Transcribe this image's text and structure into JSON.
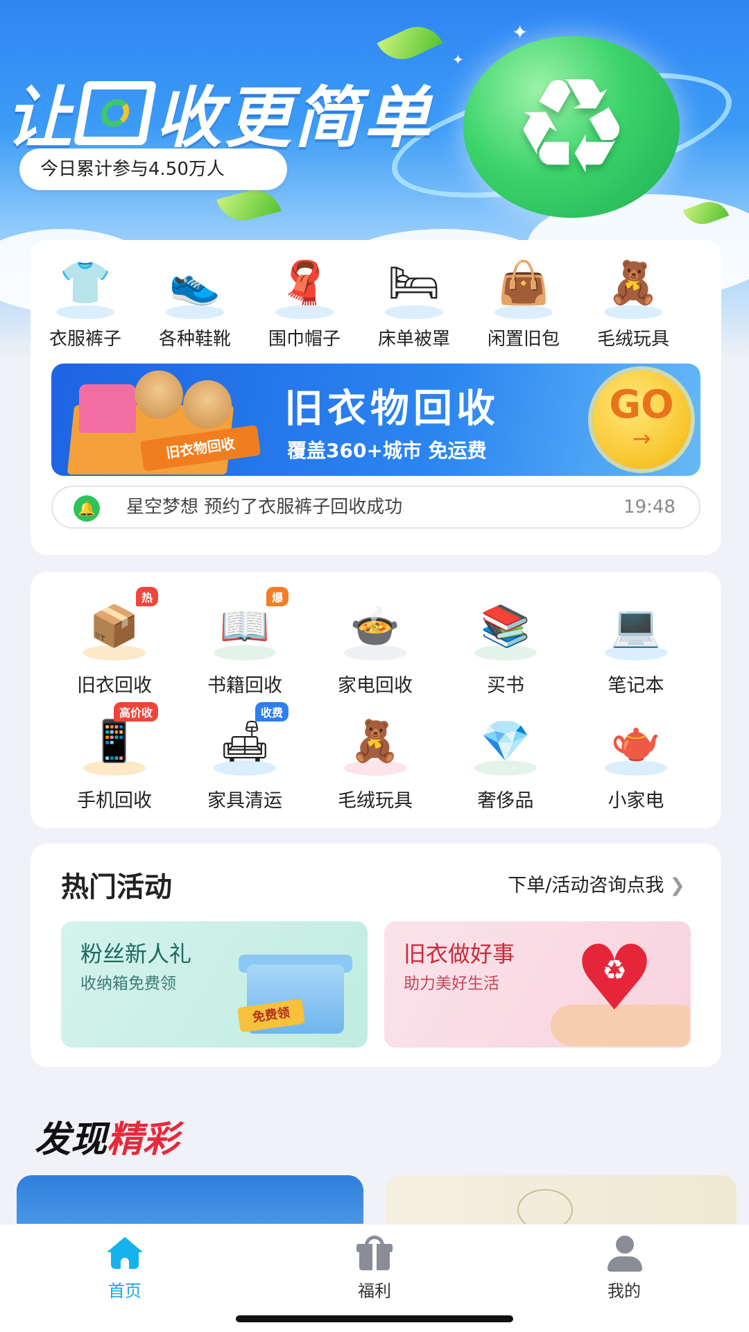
{
  "hero": {
    "title_part1": "让",
    "title_part2": "收更简单",
    "participants": "今日累计参与4.50万人"
  },
  "categories": [
    {
      "label": "衣服裤子",
      "icon": "tshirt-icon"
    },
    {
      "label": "各种鞋靴",
      "icon": "sneaker-icon"
    },
    {
      "label": "围巾帽子",
      "icon": "scarf-icon"
    },
    {
      "label": "床单被罩",
      "icon": "bed-icon"
    },
    {
      "label": "闲置旧包",
      "icon": "bag-icon"
    },
    {
      "label": "毛绒玩具",
      "icon": "teddy-bear-icon"
    }
  ],
  "banner": {
    "title": "旧衣物回收",
    "subtitle": "覆盖360+城市 免运费",
    "box_label": "旧衣物回收",
    "go": "GO",
    "go_arrow": "→"
  },
  "notice": {
    "text": "星空梦想 预约了衣服裤子回收成功",
    "time": "19:48"
  },
  "services": [
    {
      "label": "旧衣回收",
      "badge": "热",
      "badge_color": "#f0453a",
      "icon": "clothes-box-icon"
    },
    {
      "label": "书籍回收",
      "badge": "爆",
      "badge_color": "#f57c22",
      "icon": "open-book-icon"
    },
    {
      "label": "家电回收",
      "badge": "",
      "badge_color": "",
      "icon": "rice-cooker-icon"
    },
    {
      "label": "买书",
      "badge": "",
      "badge_color": "",
      "icon": "books-star-icon"
    },
    {
      "label": "笔记本",
      "badge": "",
      "badge_color": "",
      "icon": "laptop-icon"
    },
    {
      "label": "手机回收",
      "badge": "高价收",
      "badge_color": "#f0453a",
      "icon": "phone-box-icon"
    },
    {
      "label": "家具清运",
      "badge": "收费",
      "badge_color": "#2d7ff0",
      "icon": "furniture-icon"
    },
    {
      "label": "毛绒玩具",
      "badge": "",
      "badge_color": "",
      "icon": "teddy-bear-icon"
    },
    {
      "label": "奢侈品",
      "badge": "",
      "badge_color": "",
      "icon": "diamond-icon"
    },
    {
      "label": "小家电",
      "badge": "",
      "badge_color": "",
      "icon": "kettle-icon"
    }
  ],
  "hot": {
    "title": "热门活动",
    "link": "下单/活动咨询点我",
    "promo_left": {
      "title": "粉丝新人礼",
      "subtitle": "收纳箱免费领",
      "tag": "免费领"
    },
    "promo_right": {
      "title": "旧衣做好事",
      "subtitle": "助力美好生活"
    }
  },
  "discover": {
    "title_a": "发现",
    "title_b": "精彩"
  },
  "tabs": [
    {
      "label": "首页",
      "icon": "home-icon",
      "active": true
    },
    {
      "label": "福利",
      "icon": "gift-icon",
      "active": false
    },
    {
      "label": "我的",
      "icon": "user-icon",
      "active": false
    }
  ],
  "colors": {
    "accent": "#15b2ee",
    "hero_blue": "#2f86f3",
    "notice_green": "#2fc25b",
    "discover_red": "#e8283b"
  }
}
